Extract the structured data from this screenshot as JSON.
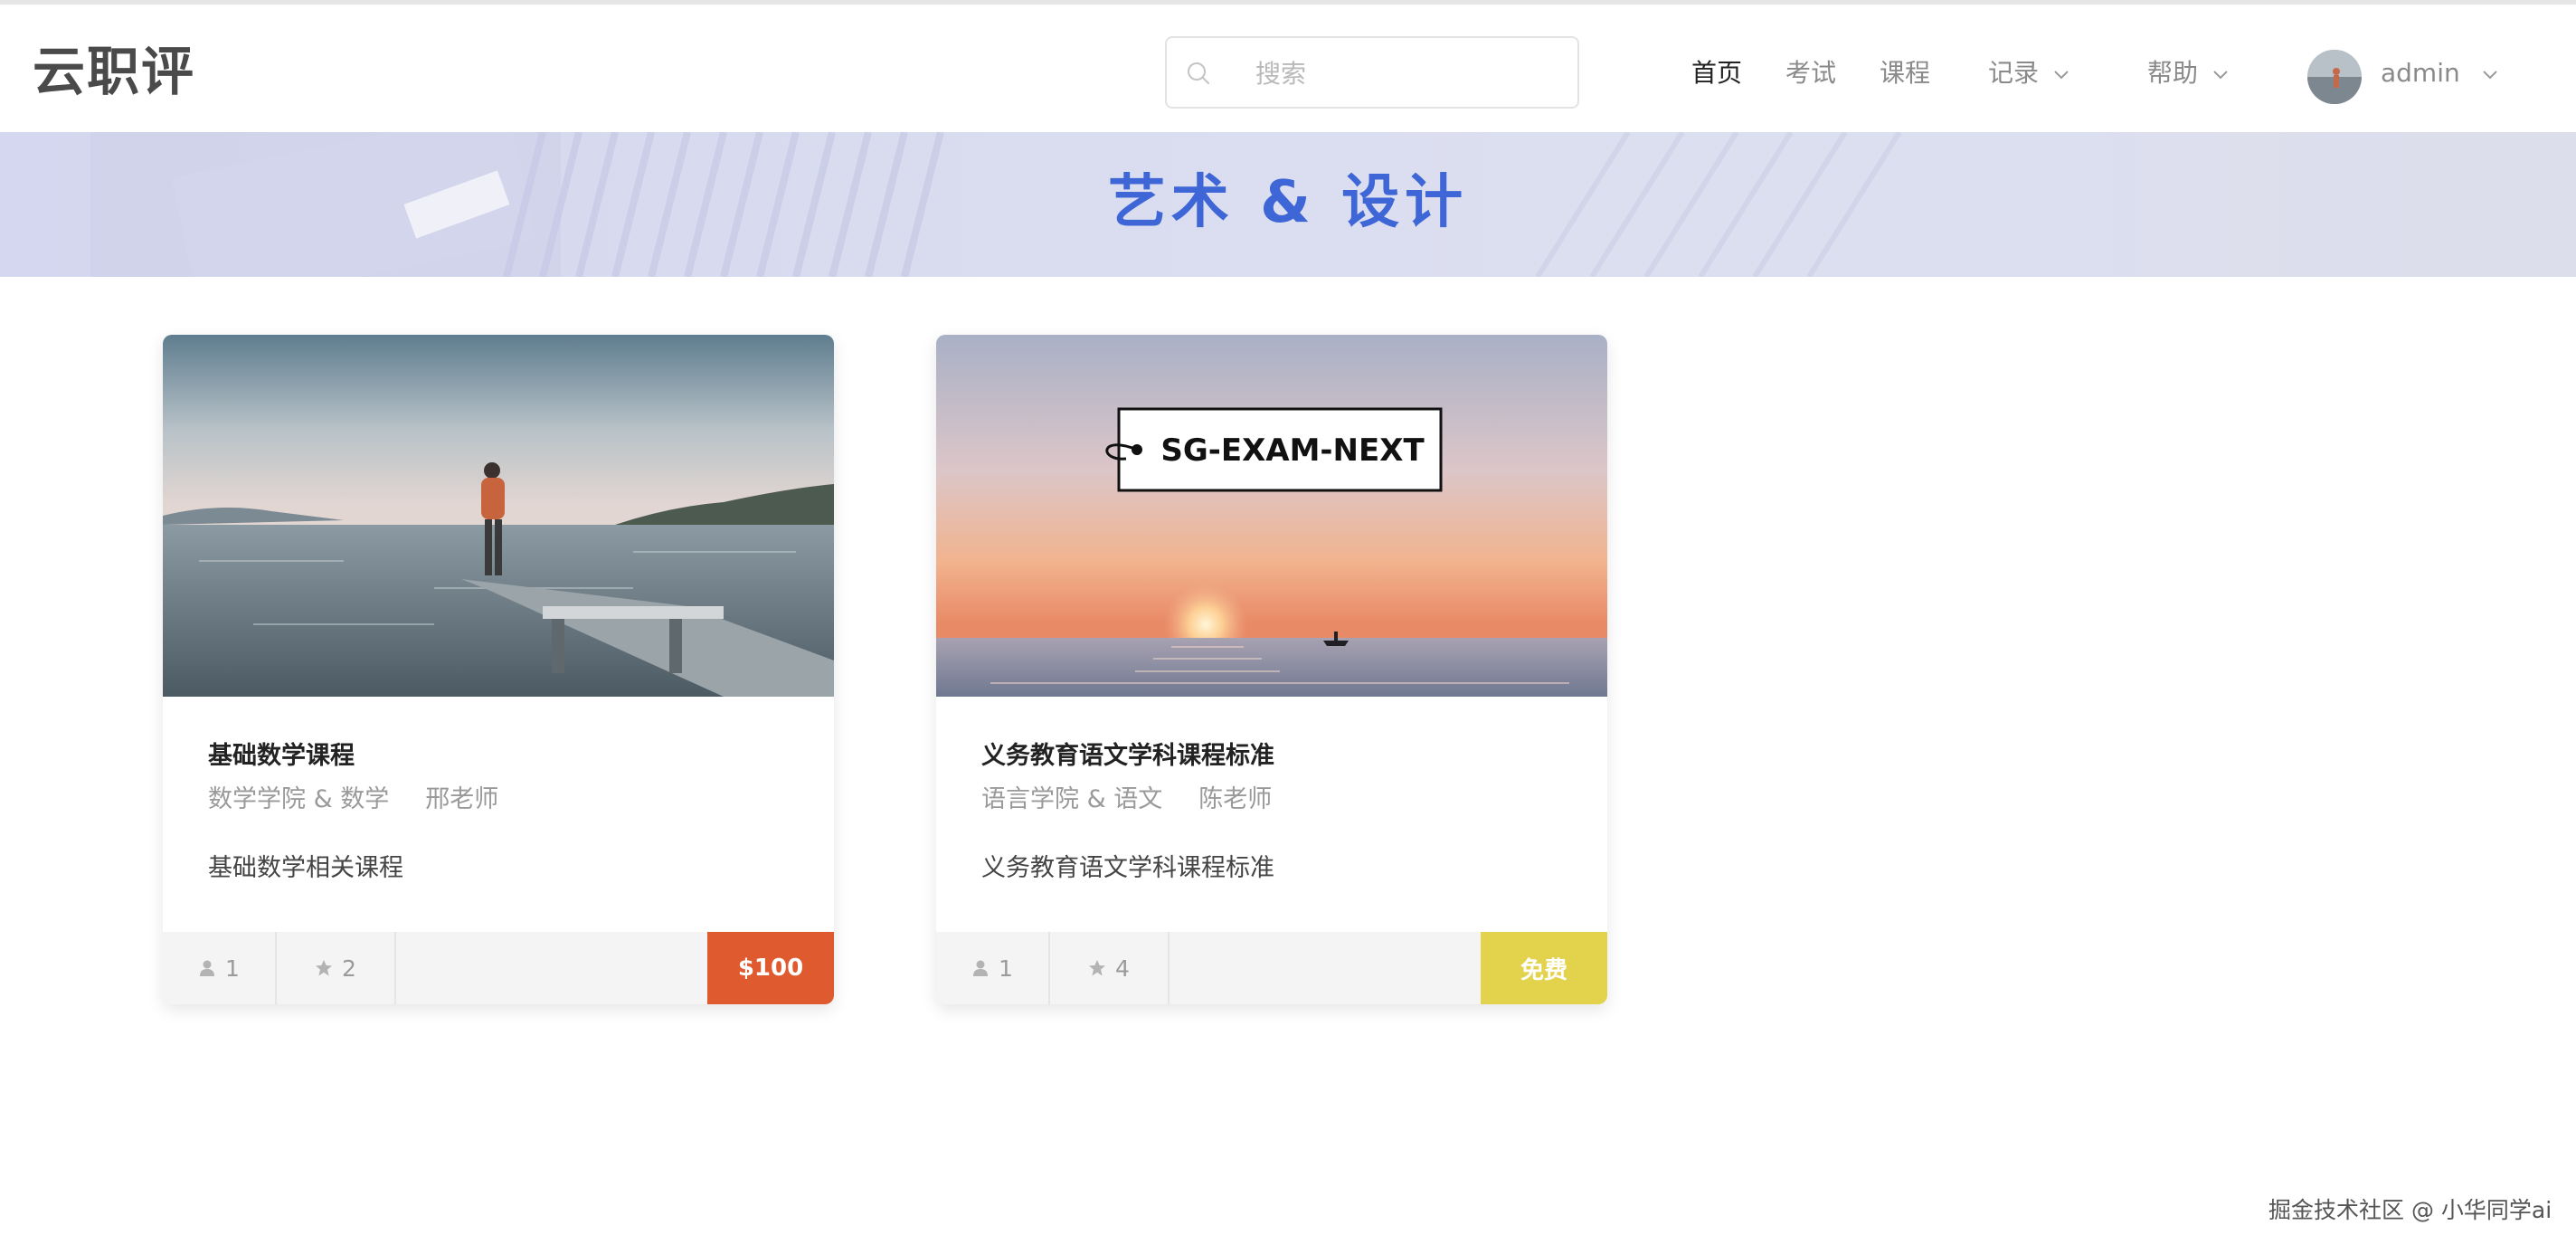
{
  "app": {
    "title": "云职评"
  },
  "search": {
    "placeholder": "搜索"
  },
  "nav": {
    "home": "首页",
    "exam": "考试",
    "course": "课程",
    "records": "记录",
    "help": "帮助"
  },
  "user": {
    "name": "admin"
  },
  "banner": {
    "title": "艺术 & 设计"
  },
  "courses": [
    {
      "title": "基础数学课程",
      "department": "数学学院 & 数学",
      "teacher": "邢老师",
      "description": "基础数学相关课程",
      "students": "1",
      "stars": "2",
      "price": "$100",
      "price_color": "#e05a2f"
    },
    {
      "title": "义务教育语文学科课程标准",
      "department": "语言学院 & 语文",
      "teacher": "陈老师",
      "description": "义务教育语文学科课程标准",
      "students": "1",
      "stars": "4",
      "price": "免费",
      "price_color": "#e3d24c",
      "cover_text": "SG-EXAM-NEXT"
    }
  ],
  "watermark": "掘金技术社区 @ 小华同学ai",
  "colors": {
    "accent": "#3e66d6",
    "nav_active": "#222222",
    "nav_inactive": "#8a8a8a"
  }
}
